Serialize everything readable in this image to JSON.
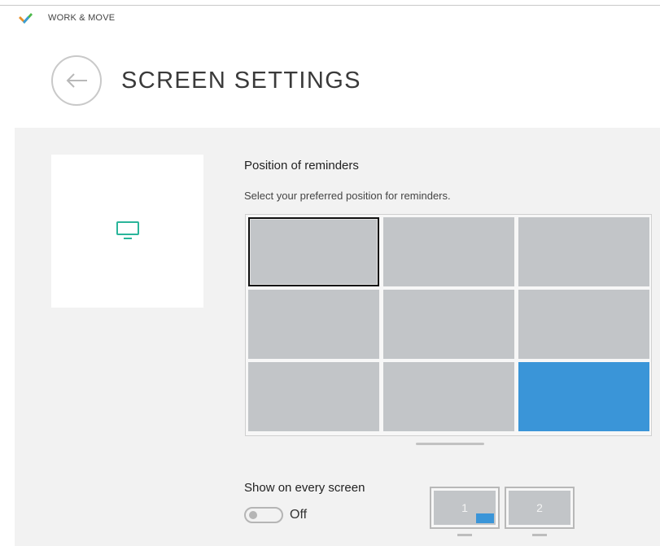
{
  "app": {
    "title": "WORK & MOVE",
    "logo_icon": "checkmark-logo-icon",
    "logo_colors": [
      "#e8902a",
      "#3c9bd8",
      "#4bb84a"
    ]
  },
  "header": {
    "back_icon": "arrow-left-icon",
    "title": "SCREEN SETTINGS"
  },
  "preview": {
    "icon": "monitor-icon",
    "icon_color": "#2ab59a"
  },
  "reminders": {
    "title": "Position of reminders",
    "subtitle": "Select your preferred position for reminders.",
    "positions": [
      {
        "name": "top-left",
        "state": "focused"
      },
      {
        "name": "top-center",
        "state": "default"
      },
      {
        "name": "top-right",
        "state": "default"
      },
      {
        "name": "middle-left",
        "state": "default"
      },
      {
        "name": "middle-center",
        "state": "default"
      },
      {
        "name": "middle-right",
        "state": "default"
      },
      {
        "name": "bottom-left",
        "state": "default"
      },
      {
        "name": "bottom-center",
        "state": "default"
      },
      {
        "name": "bottom-right",
        "state": "active"
      }
    ],
    "active_color": "#3a95d8",
    "default_color": "#c2c5c8"
  },
  "every_screen": {
    "title": "Show on every screen",
    "toggle_state": "Off",
    "screens": [
      {
        "label": "1",
        "has_indicator": true
      },
      {
        "label": "2",
        "has_indicator": false
      }
    ]
  }
}
